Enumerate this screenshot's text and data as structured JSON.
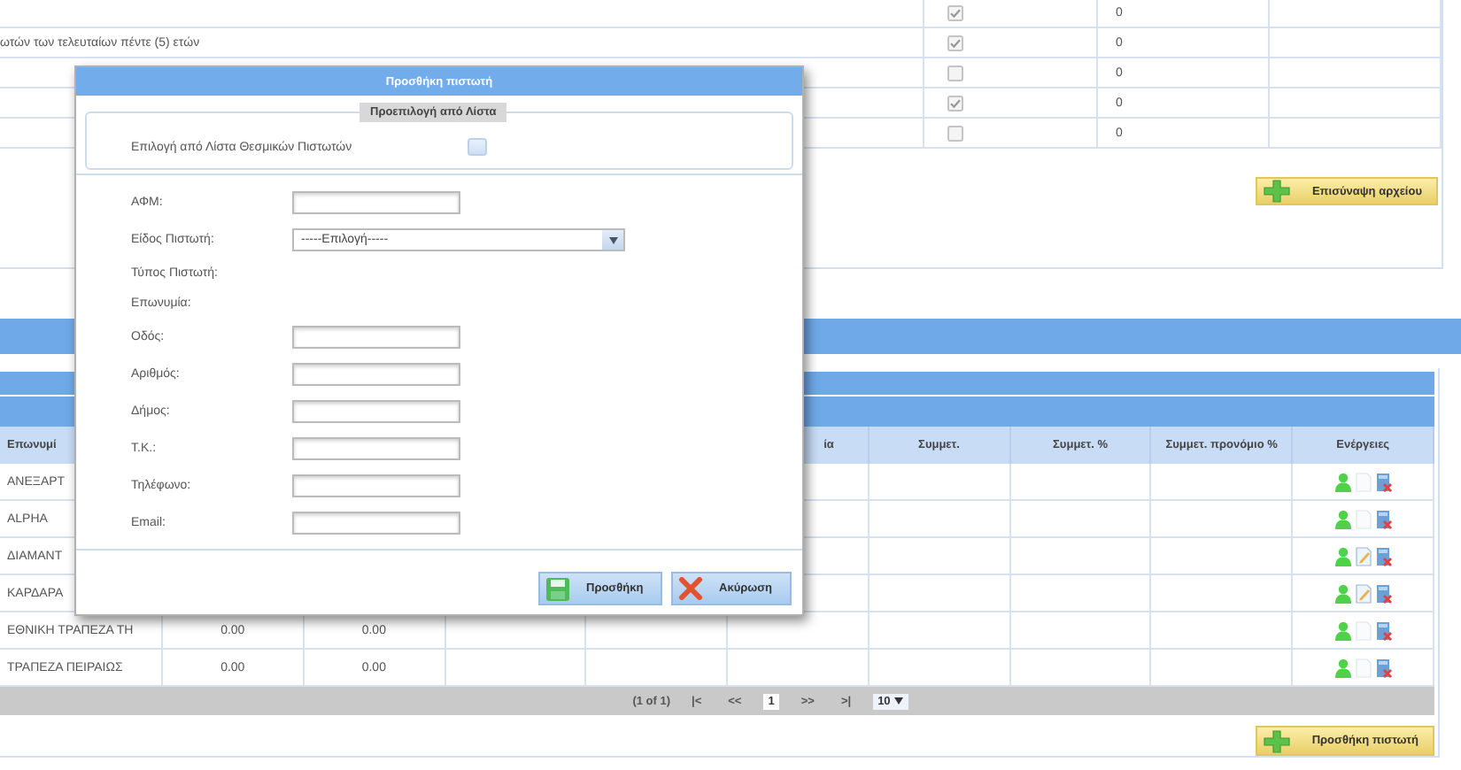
{
  "top_table": {
    "rows": [
      {
        "checked": true,
        "value": "0"
      },
      {
        "description": "ωτών των τελευταίων πέντε (5) ετών",
        "checked": true,
        "value": "0"
      },
      {
        "checked": false,
        "value": "0"
      },
      {
        "checked": true,
        "value": "0"
      },
      {
        "checked": false,
        "value": "0"
      }
    ]
  },
  "attach_button": "Επισύναψη αρχείου",
  "creditors_table": {
    "columns": {
      "column_1": "Επωνυμί",
      "column_6": "ία",
      "column_7": "Συμμετ.",
      "column_8": "Συμμετ. %",
      "column_9": "Συμμετ. προνόμιο %",
      "column_10": "Ενέργειες"
    },
    "rows": [
      {
        "name": "ΑΝΕΞΑΡΤ",
        "edit_enabled": false
      },
      {
        "name": "ALPHA",
        "edit_enabled": false
      },
      {
        "name": "ΔΙΑΜΑΝΤ",
        "edit_enabled": true
      },
      {
        "name": "ΚΑΡΔΑΡΑ",
        "edit_enabled": true
      },
      {
        "name": "ΕΘΝΙΚΗ ΤΡΑΠΕΖΑ ΤΗ",
        "column_2": "0.00",
        "column_3": "0.00",
        "edit_enabled": false
      },
      {
        "name": "ΤΡΑΠΕΖΑ ΠΕΙΡΑΙΩΣ",
        "column_2": "0.00",
        "column_3": "0.00",
        "edit_enabled": false
      }
    ],
    "pager": {
      "summary": "(1 of 1)",
      "buttons": [
        {
          "label": "|<",
          "selected": false
        },
        {
          "label": "<<",
          "selected": false
        },
        {
          "label": "1",
          "selected": true
        },
        {
          "label": ">>",
          "selected": false
        },
        {
          "label": ">|",
          "selected": false
        }
      ],
      "rows_per_page": "10"
    }
  },
  "add_creditor_button": "Προσθήκη πιστωτή",
  "dialog": {
    "title": "Προσθήκη πιστωτή",
    "preset": {
      "legend": "Προεπιλογή από Λίστα",
      "label": "Επιλογή από Λίστα Θεσμικών Πιστωτών",
      "checked": false
    },
    "fields": [
      {
        "kind": "input",
        "label": "ΑΦΜ:"
      },
      {
        "kind": "select",
        "label": "Είδος Πιστωτή:",
        "value": "-----Επιλογή-----"
      },
      {
        "kind": "text",
        "label": "Τύπος Πιστωτή:"
      },
      {
        "kind": "text",
        "label": "Επωνυμία:"
      },
      {
        "kind": "input",
        "label": "Οδός:"
      },
      {
        "kind": "input",
        "label": "Αριθμός:"
      },
      {
        "kind": "input",
        "label": "Δήμος:"
      },
      {
        "kind": "input",
        "label": "Τ.Κ.:"
      },
      {
        "kind": "input",
        "label": "Τηλέφωνο:"
      },
      {
        "kind": "input",
        "label": "Email:"
      }
    ],
    "buttons": [
      {
        "kind": "save",
        "label": "Προσθήκη"
      },
      {
        "kind": "cancel",
        "label": "Ακύρωση"
      }
    ]
  }
}
